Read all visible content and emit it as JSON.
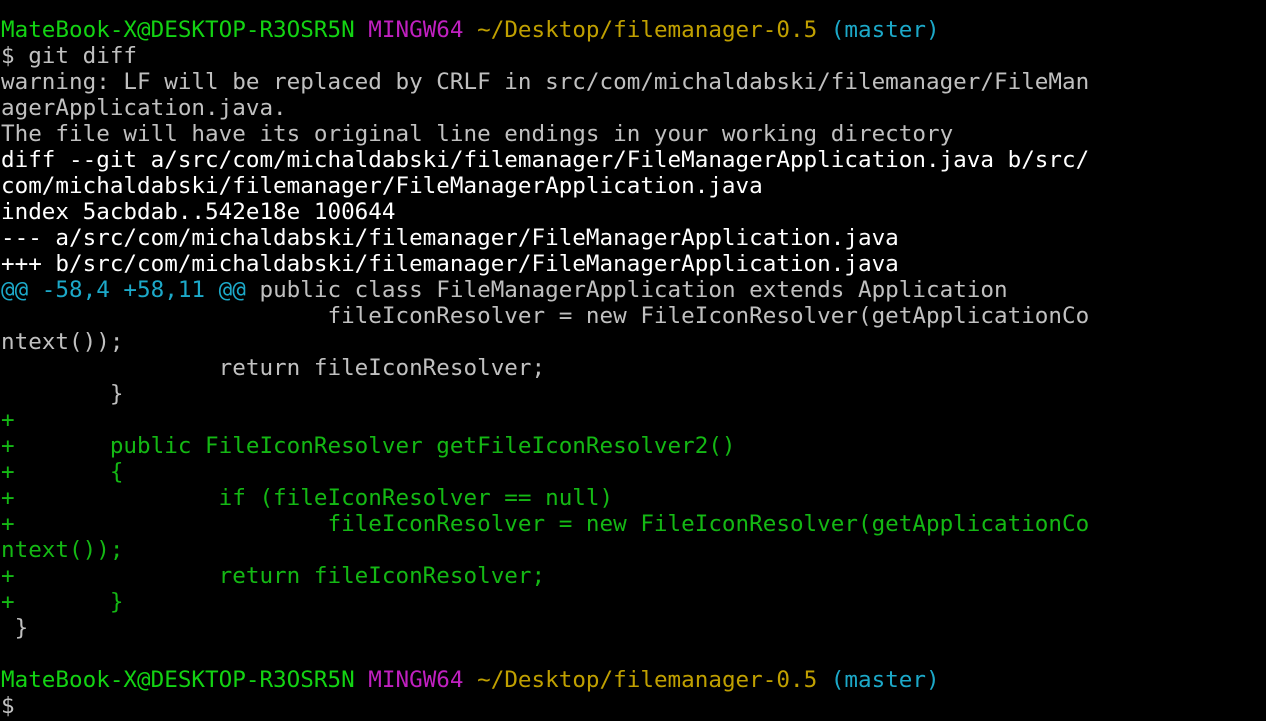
{
  "terminal": {
    "colors": {
      "background": "#000000",
      "default_text": "#c0c0c0",
      "user_host": "#13d313",
      "env": "#c020c0",
      "path": "#c0a000",
      "branch": "#1ca9c9",
      "bold_header": "#ffffff",
      "added_line": "#14b814",
      "hunk_header": "#1ca9c9"
    },
    "lines": [
      {
        "name": "prompt-header",
        "segments": [
          {
            "text": "MateBook-X@DESKTOP-R3OSR5N",
            "color": "c-green",
            "name": "user-host"
          },
          {
            "text": " ",
            "color": "c-gray",
            "name": "space"
          },
          {
            "text": "MINGW64",
            "color": "c-magenta",
            "name": "env-label"
          },
          {
            "text": " ",
            "color": "c-gray",
            "name": "space"
          },
          {
            "text": "~/Desktop/filemanager-0.5",
            "color": "c-yellow",
            "name": "current-path"
          },
          {
            "text": " ",
            "color": "c-gray",
            "name": "space"
          },
          {
            "text": "(master)",
            "color": "c-cyan",
            "name": "git-branch"
          }
        ]
      },
      {
        "name": "command-line",
        "segments": [
          {
            "text": "$ git diff",
            "color": "c-gray",
            "name": "command-text"
          }
        ]
      },
      {
        "name": "warning-line",
        "segments": [
          {
            "text": "warning: LF will be replaced by CRLF in src/com/michaldabski/filemanager/FileMan",
            "color": "c-gray",
            "name": "warning-text"
          }
        ]
      },
      {
        "name": "warning-line",
        "segments": [
          {
            "text": "agerApplication.java.",
            "color": "c-gray",
            "name": "warning-text"
          }
        ]
      },
      {
        "name": "warning-line",
        "segments": [
          {
            "text": "The file will have its original line endings in your working directory",
            "color": "c-gray",
            "name": "warning-text"
          }
        ]
      },
      {
        "name": "diff-header-line",
        "segments": [
          {
            "text": "diff --git a/src/com/michaldabski/filemanager/FileManagerApplication.java b/src/",
            "color": "c-white",
            "name": "diff-header-text"
          }
        ]
      },
      {
        "name": "diff-header-line",
        "segments": [
          {
            "text": "com/michaldabski/filemanager/FileManagerApplication.java",
            "color": "c-white",
            "name": "diff-header-text"
          }
        ]
      },
      {
        "name": "diff-header-line",
        "segments": [
          {
            "text": "index 5acbdab..542e18e 100644",
            "color": "c-white",
            "name": "diff-header-text"
          }
        ]
      },
      {
        "name": "diff-header-line",
        "segments": [
          {
            "text": "--- a/src/com/michaldabski/filemanager/FileManagerApplication.java",
            "color": "c-white",
            "name": "diff-header-text"
          }
        ]
      },
      {
        "name": "diff-header-line",
        "segments": [
          {
            "text": "+++ b/src/com/michaldabski/filemanager/FileManagerApplication.java",
            "color": "c-white",
            "name": "diff-header-text"
          }
        ]
      },
      {
        "name": "hunk-header-line",
        "segments": [
          {
            "text": "@@ -58,4 +58,11 @@",
            "color": "c-hunk",
            "name": "hunk-range"
          },
          {
            "text": " public class FileManagerApplication extends Application",
            "color": "c-gray",
            "name": "hunk-context"
          }
        ]
      },
      {
        "name": "context-line",
        "segments": [
          {
            "text": "                        fileIconResolver = new FileIconResolver(getApplicationCo",
            "color": "c-gray",
            "name": "context-text"
          }
        ]
      },
      {
        "name": "context-line",
        "segments": [
          {
            "text": "ntext());",
            "color": "c-gray",
            "name": "context-text"
          }
        ]
      },
      {
        "name": "context-line",
        "segments": [
          {
            "text": "                return fileIconResolver;",
            "color": "c-gray",
            "name": "context-text"
          }
        ]
      },
      {
        "name": "context-line",
        "segments": [
          {
            "text": "        }",
            "color": "c-gray",
            "name": "context-text"
          }
        ]
      },
      {
        "name": "added-line",
        "segments": [
          {
            "text": "+",
            "color": "c-add",
            "name": "added-text"
          }
        ]
      },
      {
        "name": "added-line",
        "segments": [
          {
            "text": "+       public FileIconResolver getFileIconResolver2()",
            "color": "c-add",
            "name": "added-text"
          }
        ]
      },
      {
        "name": "added-line",
        "segments": [
          {
            "text": "+       {",
            "color": "c-add",
            "name": "added-text"
          }
        ]
      },
      {
        "name": "added-line",
        "segments": [
          {
            "text": "+               if (fileIconResolver == null)",
            "color": "c-add",
            "name": "added-text"
          }
        ]
      },
      {
        "name": "added-line",
        "segments": [
          {
            "text": "+                       fileIconResolver = new FileIconResolver(getApplicationCo",
            "color": "c-add",
            "name": "added-text"
          }
        ]
      },
      {
        "name": "added-line",
        "segments": [
          {
            "text": "ntext());",
            "color": "c-add",
            "name": "added-text"
          }
        ]
      },
      {
        "name": "added-line",
        "segments": [
          {
            "text": "+               return fileIconResolver;",
            "color": "c-add",
            "name": "added-text"
          }
        ]
      },
      {
        "name": "added-line",
        "segments": [
          {
            "text": "+       }",
            "color": "c-add",
            "name": "added-text"
          }
        ]
      },
      {
        "name": "context-line",
        "segments": [
          {
            "text": " }",
            "color": "c-gray",
            "name": "context-text"
          }
        ]
      },
      {
        "name": "blank-line",
        "segments": []
      },
      {
        "name": "prompt-header",
        "segments": [
          {
            "text": "MateBook-X@DESKTOP-R3OSR5N",
            "color": "c-green",
            "name": "user-host"
          },
          {
            "text": " ",
            "color": "c-gray",
            "name": "space"
          },
          {
            "text": "MINGW64",
            "color": "c-magenta",
            "name": "env-label"
          },
          {
            "text": " ",
            "color": "c-gray",
            "name": "space"
          },
          {
            "text": "~/Desktop/filemanager-0.5",
            "color": "c-yellow",
            "name": "current-path"
          },
          {
            "text": " ",
            "color": "c-gray",
            "name": "space"
          },
          {
            "text": "(master)",
            "color": "c-cyan",
            "name": "git-branch"
          }
        ]
      },
      {
        "name": "input-line",
        "segments": [
          {
            "text": "$",
            "color": "c-gray",
            "name": "prompt-symbol"
          }
        ]
      }
    ]
  }
}
